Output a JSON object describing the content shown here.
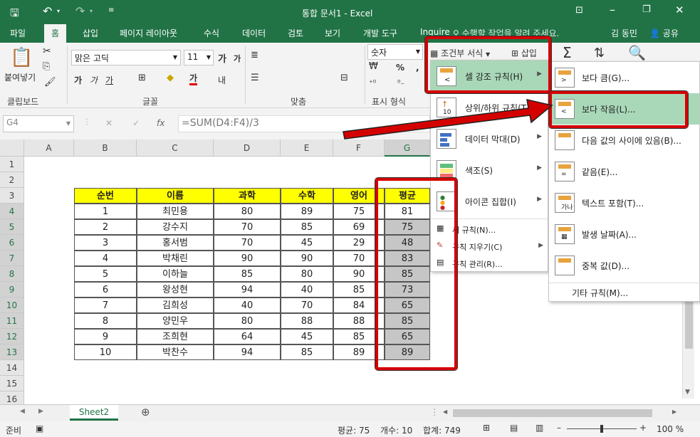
{
  "window": {
    "title": "통합 문서1 - Excel",
    "user": "김 동민",
    "share": "공유"
  },
  "tabs": [
    "파일",
    "홈",
    "삽입",
    "페이지 레이아웃",
    "수식",
    "데이터",
    "검토",
    "보기",
    "개발 도구",
    "Inquire"
  ],
  "tell_me": "수행할 작업을 알려 주세요.",
  "ribbon": {
    "paste": "붙여넣기",
    "clipboard": "클립보드",
    "font_name": "맑은 고딕",
    "font_size": "11",
    "font_group": "글꼴",
    "grow": "가",
    "shrink": "가",
    "bold": "가",
    "italic": "가",
    "underline": "가",
    "font_color": "가",
    "wrap": "내",
    "align_group": "맞춤",
    "number_format": "숫자",
    "number_group": "표시 형식",
    "cond_format": "조건부 서식",
    "insert": "삽입",
    "percent": "%",
    "comma": ","
  },
  "formula_bar": {
    "name_box": "G4",
    "fx": "fx",
    "formula": "=SUM(D4:F4)/3"
  },
  "columns": [
    "A",
    "B",
    "C",
    "D",
    "E",
    "F",
    "G"
  ],
  "rows": [
    "1",
    "2",
    "3",
    "4",
    "5",
    "6",
    "7",
    "8",
    "9",
    "10",
    "11",
    "12",
    "13",
    "14",
    "15",
    "16"
  ],
  "table": {
    "headers": [
      "순번",
      "이름",
      "과학",
      "수학",
      "영어",
      "평균"
    ],
    "rows": [
      [
        "1",
        "최민용",
        "80",
        "89",
        "75",
        "81"
      ],
      [
        "2",
        "강수지",
        "70",
        "85",
        "69",
        "75"
      ],
      [
        "3",
        "홍서범",
        "70",
        "45",
        "29",
        "48"
      ],
      [
        "4",
        "박채린",
        "90",
        "90",
        "70",
        "83"
      ],
      [
        "5",
        "이하늘",
        "85",
        "80",
        "90",
        "85"
      ],
      [
        "6",
        "왕성현",
        "94",
        "40",
        "85",
        "73"
      ],
      [
        "7",
        "김희성",
        "40",
        "70",
        "84",
        "65"
      ],
      [
        "8",
        "양민우",
        "80",
        "88",
        "88",
        "85"
      ],
      [
        "9",
        "조희현",
        "64",
        "45",
        "85",
        "65"
      ],
      [
        "10",
        "박찬수",
        "94",
        "85",
        "89",
        "89"
      ]
    ]
  },
  "menu1": {
    "items": [
      {
        "label": "셀 강조 규칙(H)"
      },
      {
        "label": "상위/하위 규칙(T)"
      },
      {
        "label": "데이터 막대(D)"
      },
      {
        "label": "색조(S)"
      },
      {
        "label": "아이콘 집합(I)"
      }
    ],
    "small": [
      "새 규칙(N)...",
      "규칙 지우기(C)",
      "규칙 관리(R)..."
    ]
  },
  "menu2": {
    "items": [
      {
        "label": "보다 큼(G)..."
      },
      {
        "label": "보다 작음(L)..."
      },
      {
        "label": "다음 값의 사이에 있음(B)..."
      },
      {
        "label": "같음(E)..."
      },
      {
        "label": "텍스트 포함(T)..."
      },
      {
        "label": "발생 날짜(A)..."
      },
      {
        "label": "중복 값(D)..."
      }
    ],
    "more": "기타 규칙(M)..."
  },
  "sheet": {
    "tab": "Sheet2"
  },
  "status": {
    "ready": "준비",
    "avg": "평균: 75",
    "count": "개수: 10",
    "sum": "합계: 749",
    "zoom": "100 %"
  },
  "colors": {
    "accent": "#217346",
    "highlight": "#ffff00",
    "red": "#d40000",
    "selected_cell": "#c6c6c6"
  }
}
